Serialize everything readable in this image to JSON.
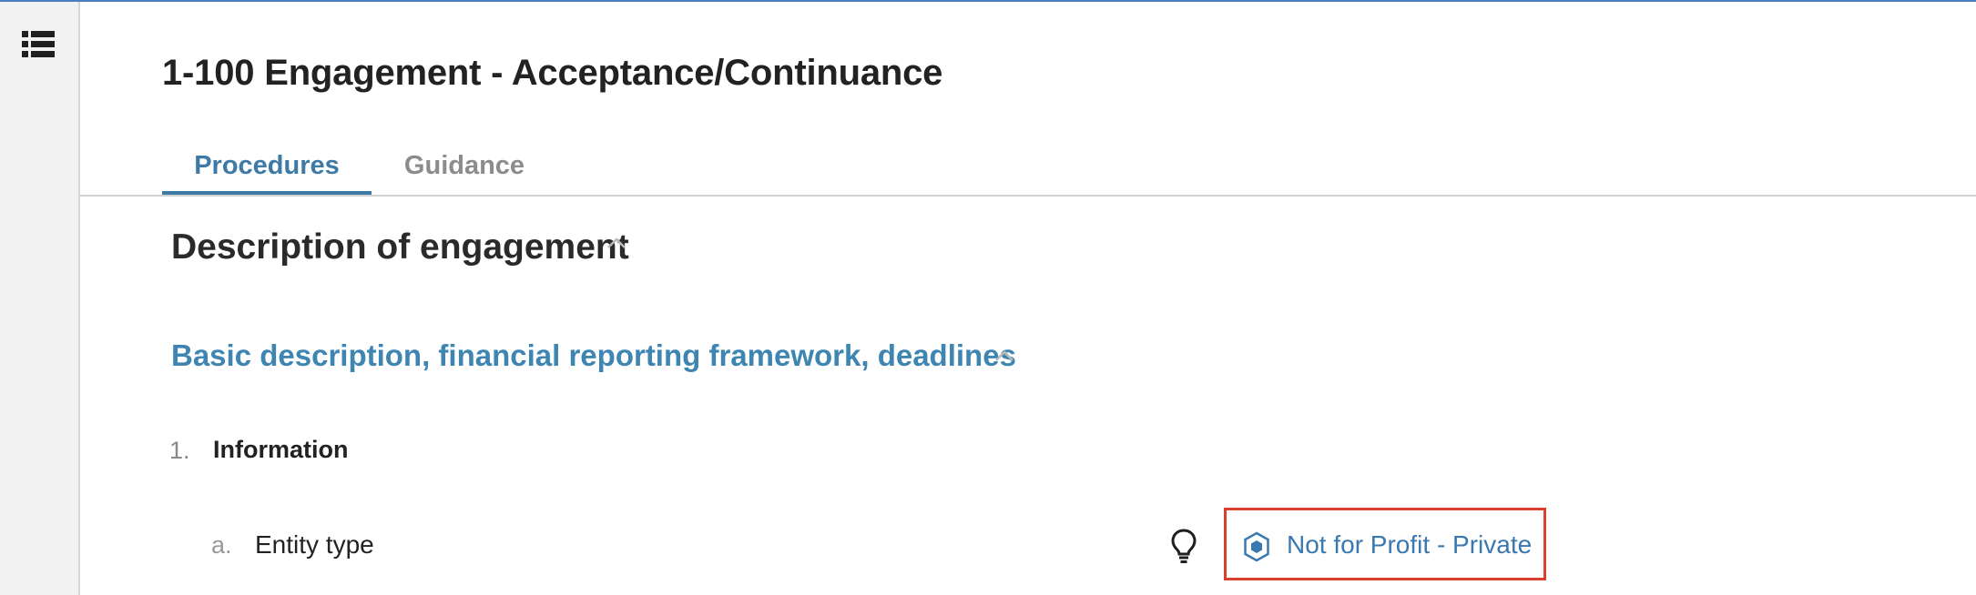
{
  "page": {
    "title": "1-100 Engagement - Acceptance/Continuance"
  },
  "sidebar": {
    "menu_icon": "list-icon"
  },
  "tabs": [
    {
      "label": "Procedures",
      "active": true
    },
    {
      "label": "Guidance",
      "active": false
    }
  ],
  "section": {
    "title": "Description of engagement",
    "subsection_title": "Basic description, financial reporting framework, deadlines"
  },
  "question": {
    "number": "1.",
    "label": "Information",
    "sub": {
      "letter": "a.",
      "label": "Entity type",
      "hint_icon": "lightbulb-icon",
      "answer_icon": "hexagon-icon",
      "answer": "Not for Profit - Private"
    }
  },
  "colors": {
    "accent": "#3e7aa6",
    "link": "#3a78b0",
    "highlight_border": "#d9402e",
    "top_border": "#4a7fc1"
  }
}
